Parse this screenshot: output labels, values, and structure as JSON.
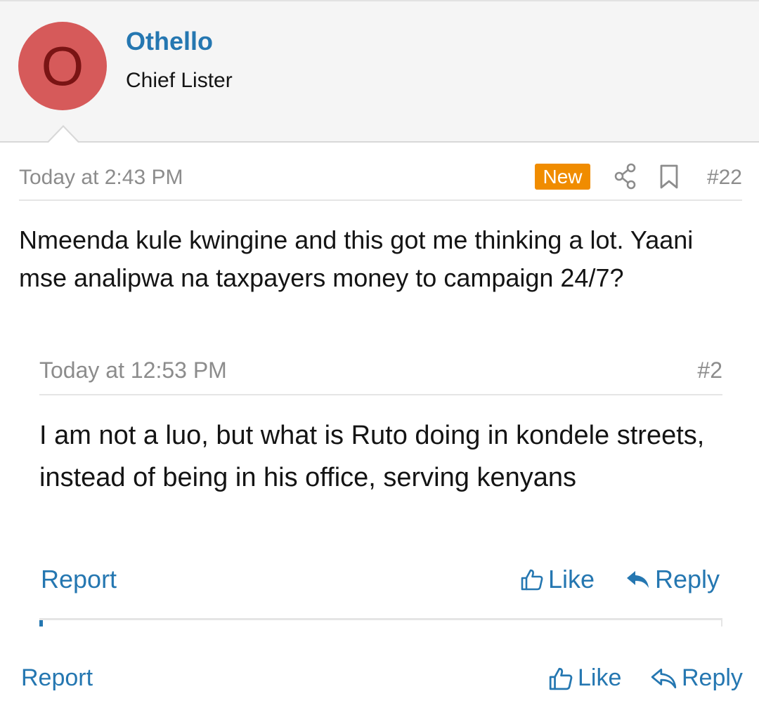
{
  "user": {
    "avatar_letter": "O",
    "avatar_color": "#d65a5a",
    "username": "Othello",
    "title": "Chief Lister"
  },
  "post": {
    "date": "Today at 2:43 PM",
    "badge": "New",
    "number": "#22",
    "icons": [
      "share-icon",
      "bookmark-icon"
    ],
    "body": "Nmeenda kule kwingine and this got me thinking a lot. Yaani mse analipwa na taxpayers money to campaign 24/7?",
    "actions": {
      "report": "Report",
      "like": "Like",
      "reply": "Reply"
    }
  },
  "quote": {
    "date": "Today at 12:53 PM",
    "number": "#2",
    "body": "I am not a luo, but what is Ruto doing in kondele streets, instead of being in his office, serving kenyans",
    "actions": {
      "report": "Report",
      "like": "Like",
      "reply": "Reply"
    }
  },
  "colors": {
    "link": "#2577b1",
    "badge": "#f08c00",
    "muted": "#8c8c8c"
  }
}
